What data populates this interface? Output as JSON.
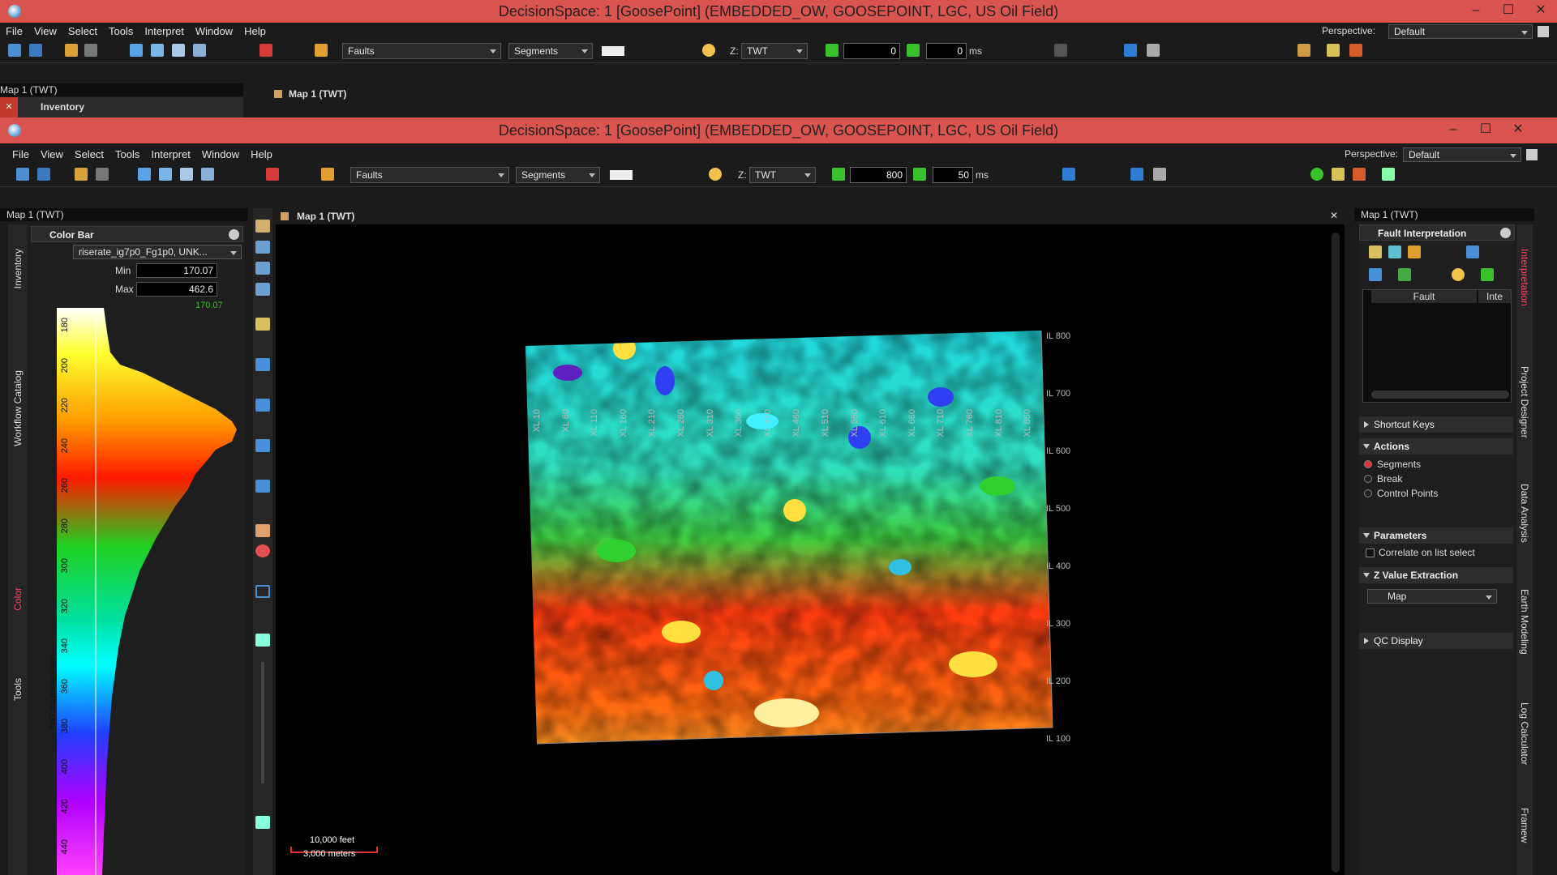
{
  "back_window": {
    "title": "DecisionSpace: 1 [GoosePoint] (EMBEDDED_OW, GOOSEPOINT, LGC, US Oil Field)",
    "menu": [
      "File",
      "View",
      "Select",
      "Tools",
      "Interpret",
      "Window",
      "Help"
    ],
    "perspective_label": "Perspective:",
    "perspective_value": "Default",
    "toolbar": {
      "faults": "Faults",
      "segments": "Segments",
      "z_label": "Z:",
      "z_value": "TWT",
      "frame": "0",
      "step": "0",
      "unit": "ms"
    },
    "panel_title": "Map 1 (TWT)",
    "inventory_tab": "Inventory",
    "map_tab": "Map 1 (TWT)"
  },
  "window": {
    "title": "DecisionSpace: 1 [GoosePoint] (EMBEDDED_OW, GOOSEPOINT, LGC, US Oil Field)",
    "menu": [
      "File",
      "View",
      "Select",
      "Tools",
      "Interpret",
      "Window",
      "Help"
    ],
    "perspective_label": "Perspective:",
    "perspective_value": "Default",
    "toolbar": {
      "faults": "Faults",
      "segments": "Segments",
      "z_label": "Z:",
      "z_value": "TWT",
      "frame": "800",
      "step": "50",
      "unit": "ms"
    }
  },
  "left_panel": {
    "panel_title": "Map 1 (TWT)",
    "tabs": [
      "Inventory",
      "Workflow Catalog",
      "Color",
      "Tools"
    ],
    "color_bar": {
      "title": "Color Bar",
      "attribute": "riserate_ig7p0_Fg1p0, UNK...",
      "min_label": "Min",
      "min_value": "170.07",
      "max_label": "Max",
      "max_value": "462.6",
      "marker_value": "170.07",
      "axis_label": "TWT ms below 0 feet",
      "ticks": [
        "180",
        "200",
        "220",
        "240",
        "260",
        "280",
        "300",
        "320",
        "340",
        "360",
        "380",
        "400",
        "420",
        "440"
      ]
    }
  },
  "map": {
    "tab": "Map 1 (TWT)",
    "xl_labels": [
      "XL 10",
      "XL 60",
      "XL 110",
      "XL 160",
      "XL 210",
      "XL 260",
      "XL 310",
      "XL 360",
      "XL 410",
      "XL 460",
      "XL 510",
      "XL 560",
      "XL 610",
      "XL 660",
      "XL 710",
      "XL 760",
      "XL 810",
      "XL 860"
    ],
    "il_labels": [
      "IL 800",
      "IL 700",
      "IL 600",
      "IL 500",
      "IL 400",
      "IL 300",
      "IL 200",
      "IL 100"
    ],
    "scale_feet": "10,000 feet",
    "scale_meters": "3,000 meters"
  },
  "right_panel": {
    "panel_title": "Map 1 (TWT)",
    "title": "Fault Interpretation",
    "table_headers": [
      "Fault",
      "Inte"
    ],
    "sections": {
      "shortcut": "Shortcut Keys",
      "actions": "Actions",
      "parameters": "Parameters",
      "zvalue": "Z Value Extraction",
      "qc": "QC Display"
    },
    "actions": [
      "Segments",
      "Break",
      "Control Points"
    ],
    "correlate": "Correlate on list select",
    "z_source": "Map",
    "side_tabs": [
      "Interpretation",
      "Project Designer",
      "Data Analysis",
      "Earth Modeling",
      "Log Calculator",
      "Framew"
    ]
  },
  "colors": {
    "title_bar": "#d9534f",
    "panel_bg": "#1b1b1b",
    "accent_green": "#39c12d"
  }
}
